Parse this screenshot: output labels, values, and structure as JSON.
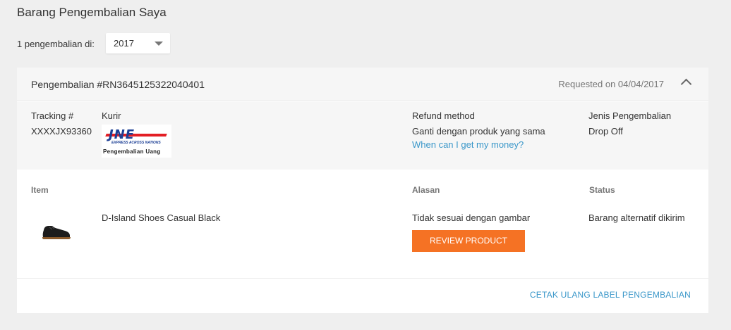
{
  "page": {
    "title": "Barang Pengembalian Saya"
  },
  "filter": {
    "label": "1 pengembalian di:",
    "year": "2017"
  },
  "return": {
    "id_label": "Pengembalian #RN3645125322040401",
    "requested": "Requested on 04/04/2017",
    "tracking_label": "Tracking #",
    "tracking_value": "XXXXJX93360",
    "courier_label": "Kurir",
    "courier_logo": {
      "mark": "JNE",
      "tagline": "EXPRESS ACROSS NATIONS",
      "sub": "Pengembalian Uang"
    },
    "refund_label": "Refund method",
    "refund_value": "Ganti dengan produk yang sama",
    "refund_link": "When can I get my money?",
    "type_label": "Jenis Pengembalian",
    "type_value": "Drop Off"
  },
  "items_table": {
    "headers": {
      "item": "Item",
      "reason": "Alasan",
      "status": "Status"
    },
    "rows": [
      {
        "name": "D-Island Shoes Casual Black",
        "reason": "Tidak sesuai dengan gambar",
        "status": "Barang alternatif dikirim",
        "action": "REVIEW PRODUCT"
      }
    ]
  },
  "footer": {
    "reprint_link": "CETAK ULANG LABEL PENGEMBALIAN"
  },
  "colors": {
    "accent": "#f57224",
    "link": "#3a97c9",
    "background": "#efefef"
  }
}
